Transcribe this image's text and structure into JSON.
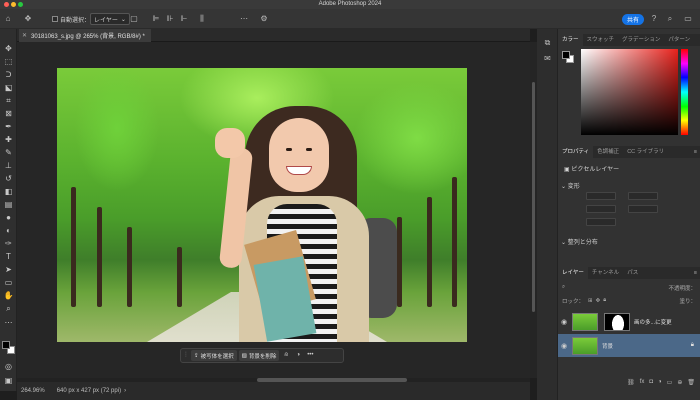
{
  "window": {
    "title": "Adobe Photoshop 2024",
    "traffic_colors": [
      "#ff5f57",
      "#febc2e",
      "#28c840"
    ]
  },
  "options_bar": {
    "auto_select_label": "自動選択：",
    "layer_select_value": "レイヤー",
    "share_label": "共有"
  },
  "document": {
    "tab_title": "30181063_s.jpg @ 265% (背景, RGB/8#) *"
  },
  "taskbar": {
    "select_subject": "被写体を選択",
    "remove_background": "背景を削除",
    "more": "•••"
  },
  "status": {
    "zoom": "264.96%",
    "dimensions": "640 px x 427 px (72 ppi)"
  },
  "color_panel": {
    "tabs": [
      "カラー",
      "スウォッチ",
      "グラデーション",
      "パターン"
    ]
  },
  "properties_panel": {
    "tabs": [
      "プロパティ",
      "色調補正",
      "CC ライブラリ"
    ],
    "layer_type": "ピクセルレイヤー",
    "transform_label": "変形",
    "align_label": "整列と分布"
  },
  "layers_panel": {
    "tabs": [
      "レイヤー",
      "チャンネル",
      "パス"
    ],
    "lock_label": "ロック：",
    "fill_label": "塗り：",
    "blend_label": "不透明度：",
    "layers": [
      {
        "name": "画の多...に変更",
        "selected": false,
        "has_mask": true
      },
      {
        "name": "背景",
        "selected": true,
        "has_mask": false
      }
    ]
  },
  "colors": {
    "accent": "#1473e6",
    "selected_layer": "#4b6888"
  }
}
